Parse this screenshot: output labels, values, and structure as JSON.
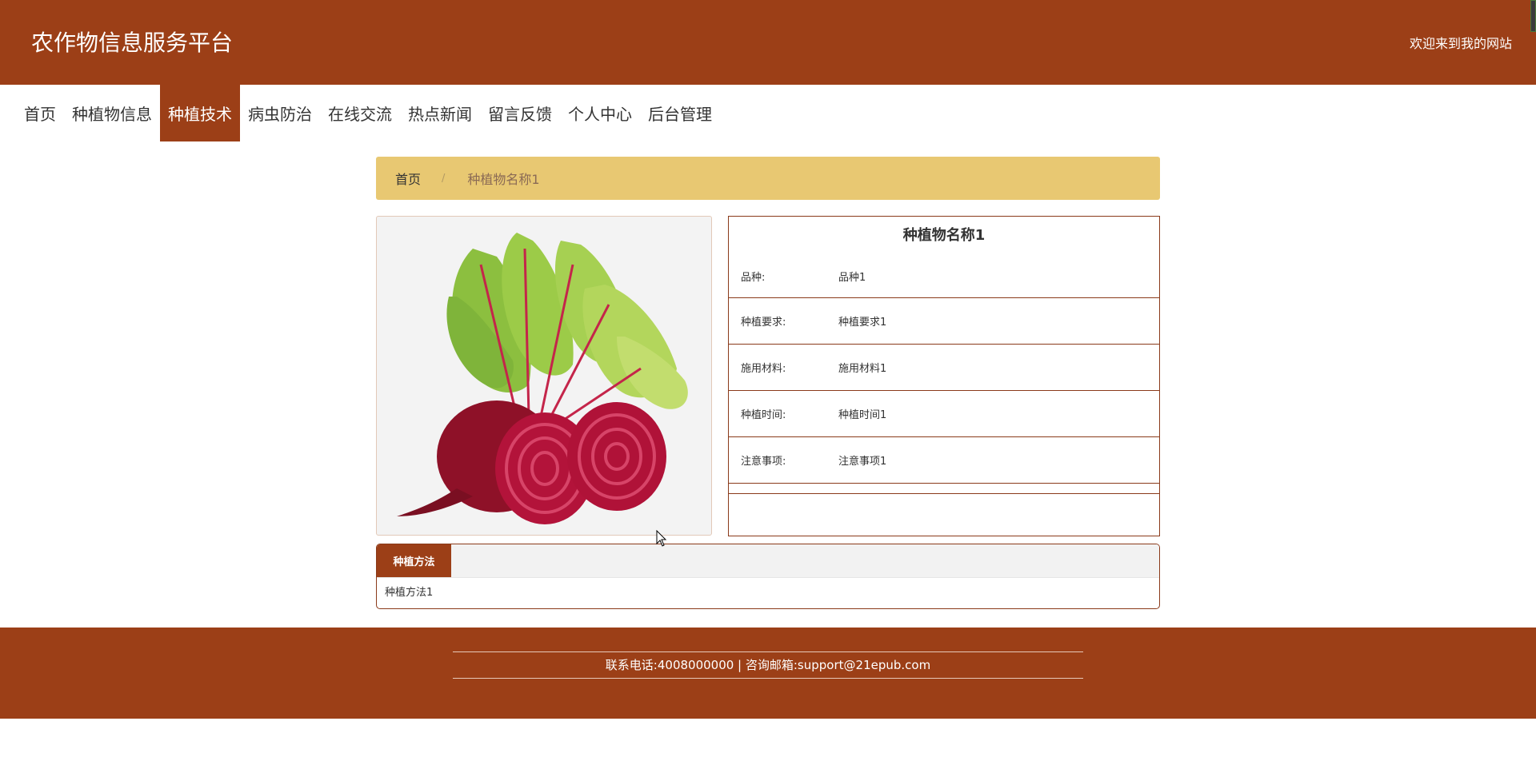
{
  "header": {
    "title": "农作物信息服务平台",
    "welcome": "欢迎来到我的网站"
  },
  "nav": {
    "items": [
      {
        "label": "首页"
      },
      {
        "label": "种植物信息"
      },
      {
        "label": "种植技术",
        "active": true
      },
      {
        "label": "病虫防治"
      },
      {
        "label": "在线交流"
      },
      {
        "label": "热点新闻"
      },
      {
        "label": "留言反馈"
      },
      {
        "label": "个人中心"
      },
      {
        "label": "后台管理"
      }
    ]
  },
  "breadcrumb": {
    "home": "首页",
    "separator": "/",
    "current": "种植物名称1"
  },
  "detail": {
    "title": "种植物名称1",
    "image_icon": "beetroot-image",
    "rows": [
      {
        "label": "品种:",
        "value": "品种1"
      },
      {
        "label": "种植要求:",
        "value": "种植要求1"
      },
      {
        "label": "施用材料:",
        "value": "施用材料1"
      },
      {
        "label": "种植时间:",
        "value": "种植时间1"
      },
      {
        "label": "注意事项:",
        "value": "注意事项1"
      }
    ]
  },
  "tabs": {
    "active_label": "种植方法",
    "content": "种植方法1"
  },
  "footer": {
    "contact": "联系电话:4008000000 | 咨询邮箱:support@21epub.com"
  },
  "colors": {
    "primary": "#9c3f17",
    "breadcrumb_bg": "#e8c872"
  }
}
